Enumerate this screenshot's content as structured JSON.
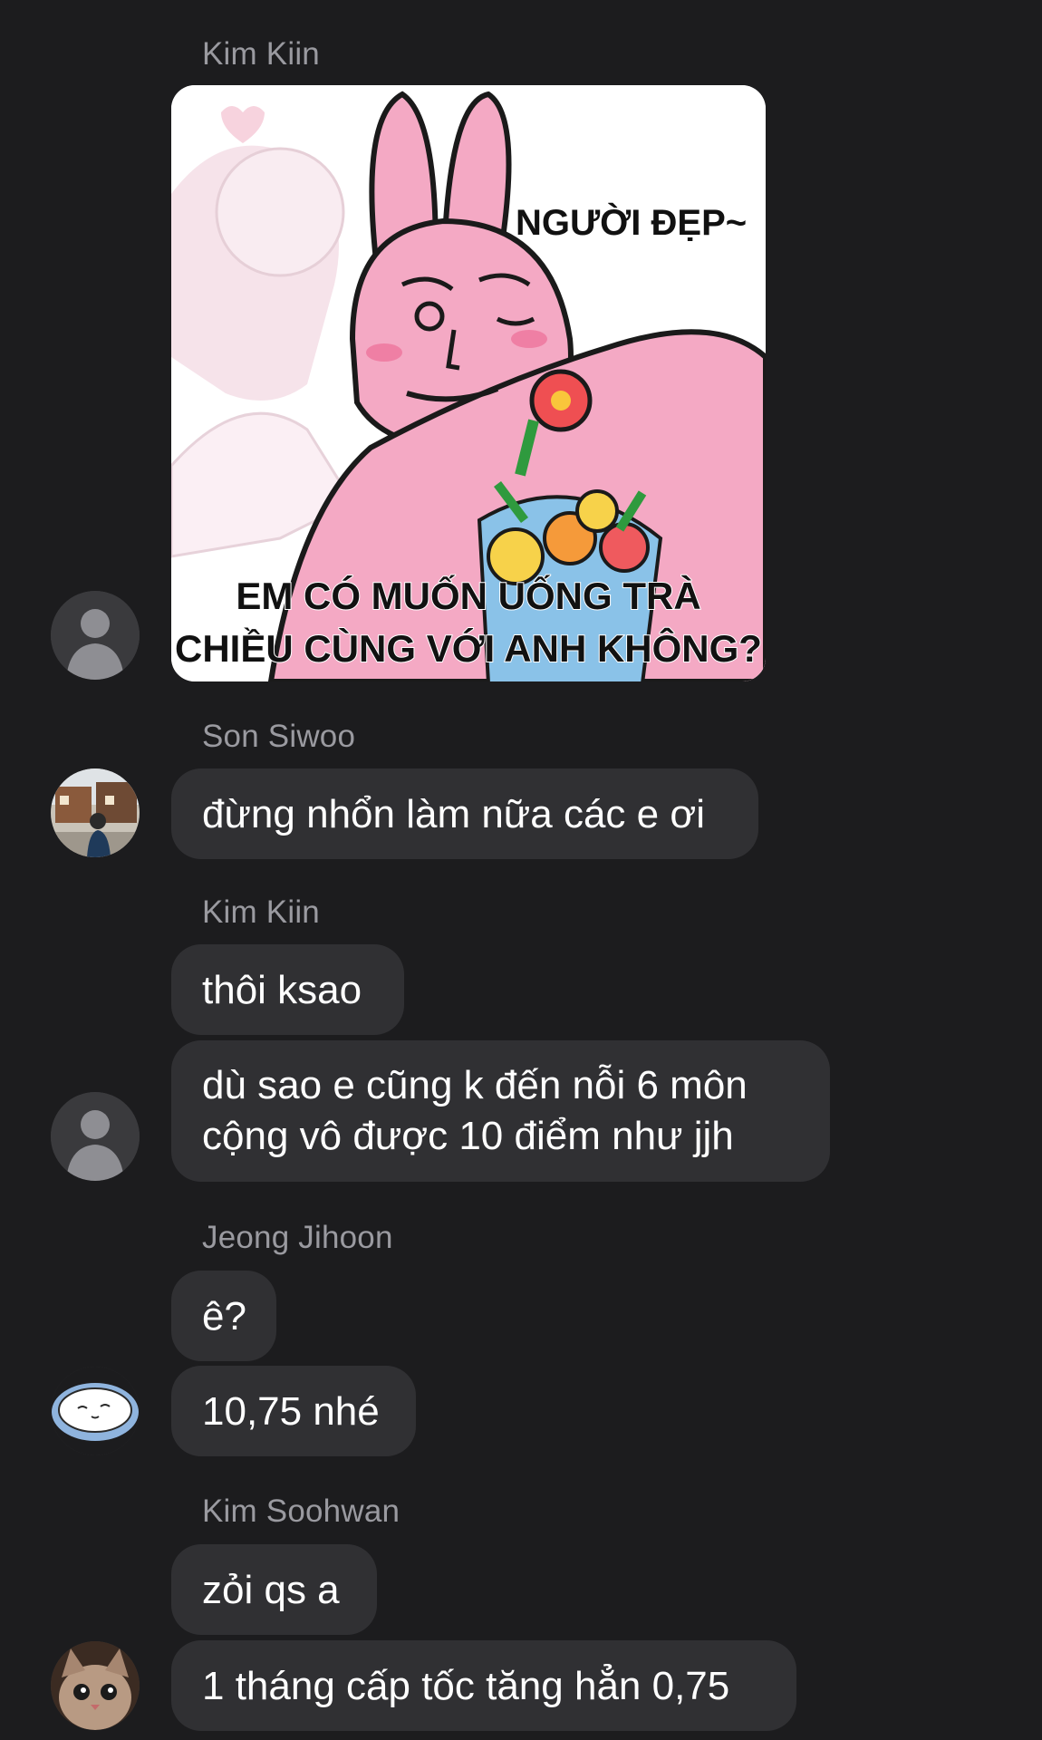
{
  "messages": [
    {
      "sender": "Kim Kiin",
      "sticker": {
        "caption_top": "NGƯỜI ĐẸP~",
        "caption_line1": "EM CÓ MUỐN UỐNG TRÀ",
        "caption_line2": "CHIỀU CÙNG VỚI ANH KHÔNG?"
      }
    },
    {
      "sender": "Son Siwoo",
      "bubbles": [
        "đừng nhổn làm nữa các e ơi"
      ]
    },
    {
      "sender": "Kim Kiin",
      "bubbles": [
        "thôi ksao",
        "dù sao e cũng k đến nỗi 6 môn cộng vô được 10 điểm như jjh"
      ]
    },
    {
      "sender": "Jeong Jihoon",
      "bubbles": [
        "ê?",
        "10,75 nhé"
      ]
    },
    {
      "sender": "Kim Soohwan",
      "bubbles": [
        "zỏi qs a",
        "1 tháng cấp tốc tăng hẳn 0,75"
      ]
    }
  ],
  "icons": {
    "avatar_default": "person-silhouette-icon",
    "avatar_son_siwoo": "photo-avatar",
    "avatar_jeong_jihoon": "cartoon-avatar",
    "avatar_kim_soohwan": "cat-photo-avatar"
  },
  "colors": {
    "background": "#1c1c1e",
    "bubble": "#303033",
    "sender_name": "#9a9aa0",
    "text": "#ffffff",
    "sticker_pink": "#f4a9c4"
  }
}
